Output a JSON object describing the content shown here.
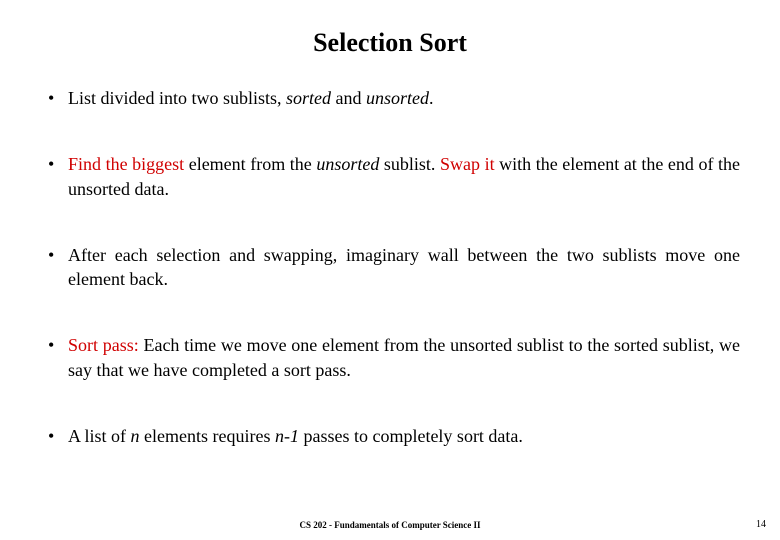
{
  "title": "Selection Sort",
  "bullets": {
    "b0": {
      "t0": "List divided into two sublists, ",
      "t1": "sorted",
      "t2": " and ",
      "t3": "unsorted",
      "t4": "."
    },
    "b1": {
      "t0": "Find the biggest",
      "t1": " element from the ",
      "t2": "unsorted",
      "t3": " sublist. ",
      "t4": "Swap it",
      "t5": " with the element at the end of the unsorted data."
    },
    "b2": {
      "t0": "After each selection and swapping, imaginary wall between the two sublists move one element back."
    },
    "b3": {
      "t0": "Sort pass:",
      "t1": " Each time we move one element from the unsorted sublist to the sorted sublist, we say that we have completed a sort pass."
    },
    "b4": {
      "t0": "A list of ",
      "t1": "n",
      "t2": " elements requires ",
      "t3": "n-1",
      "t4": " passes to completely sort data."
    }
  },
  "footer": {
    "center": "CS 202 - Fundamentals of Computer Science II",
    "page": "14"
  }
}
